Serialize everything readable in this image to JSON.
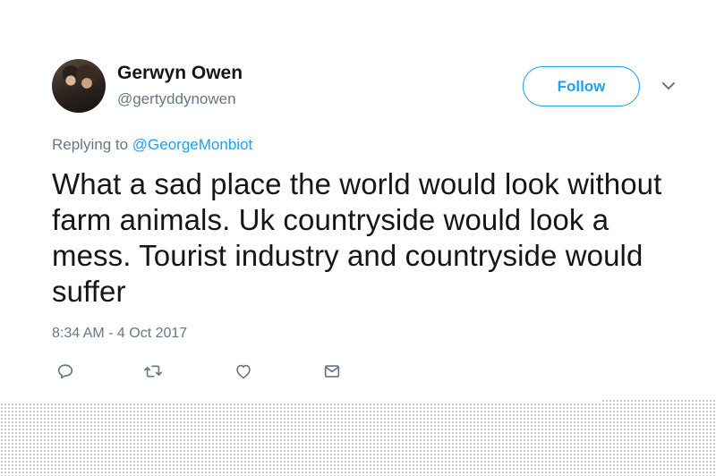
{
  "tweet": {
    "author": {
      "display_name": "Gerwyn Owen",
      "handle": "@gertyddynowen"
    },
    "follow_label": "Follow",
    "replying_prefix": "Replying to",
    "replying_to": "@GeorgeMonbiot",
    "text": "What a sad place the world would look without farm animals. Uk countryside would look a mess. Tourist industry and countryside would suffer",
    "timestamp": "8:34 AM - 4 Oct 2017"
  },
  "colors": {
    "accent": "#1da1f2",
    "secondary_text": "#657786",
    "primary_text": "#14171a"
  },
  "icons": [
    "reply-icon",
    "retweet-icon",
    "like-icon",
    "message-icon",
    "chevron-down-icon"
  ]
}
